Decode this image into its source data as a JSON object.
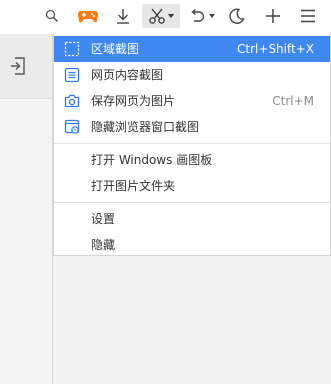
{
  "toolbar": {
    "icons": [
      "search-icon",
      "game-icon",
      "download-icon",
      "scissors-icon",
      "undo-icon",
      "moon-icon",
      "plus-icon",
      "menu-icon"
    ],
    "accent": "#ff7b1a"
  },
  "menu": {
    "items": [
      {
        "label": "区域截图",
        "shortcut": "Ctrl+Shift+X",
        "icon": "region-capture-icon",
        "highlighted": true
      },
      {
        "label": "网页内容截图",
        "shortcut": "",
        "icon": "page-content-icon"
      },
      {
        "label": "保存网页为图片",
        "shortcut": "Ctrl+M",
        "icon": "camera-icon"
      },
      {
        "label": "隐藏浏览器窗口截图",
        "shortcut": "",
        "icon": "hidden-window-icon"
      },
      {
        "label": "打开 Windows 画图板",
        "shortcut": ""
      },
      {
        "label": "打开图片文件夹",
        "shortcut": ""
      },
      {
        "label": "设置",
        "shortcut": ""
      },
      {
        "label": "隐藏",
        "shortcut": ""
      }
    ]
  },
  "colors": {
    "highlight": "#3f88f2",
    "icon_blue": "#2f7de1"
  }
}
